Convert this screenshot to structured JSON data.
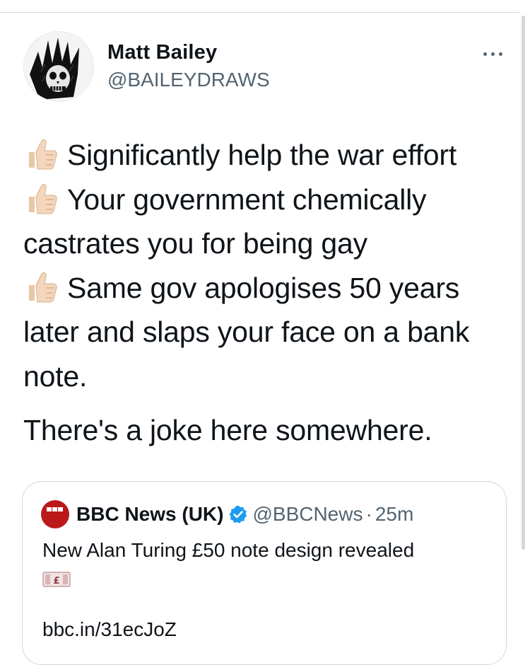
{
  "author": {
    "name": "Matt Bailey",
    "handle": "@BAILEYDRAWS",
    "avatar_icon": "crowned-skeleton-avatar-icon"
  },
  "more_icon": "more-horizontal-icon",
  "tweet": {
    "thumb_icon": "thumbs-up-emoji-icon",
    "items": [
      {
        "lines": [
          "Significantly help the war effort"
        ]
      },
      {
        "lines": [
          "Your government chemically",
          "castrates you for being gay"
        ]
      },
      {
        "lines": [
          "Same gov apologises 50 years",
          "later and slaps your face on a bank",
          "note."
        ]
      }
    ],
    "closing": "There's a joke here somewhere."
  },
  "quoted_tweet": {
    "logo_icon": "bbc-news-logo-icon",
    "name": "BBC News (UK)",
    "verified_icon": "verified-badge-icon",
    "handle": "@BBCNews",
    "separator": "·",
    "time": "25m",
    "text": "New Alan Turing £50 note design revealed",
    "emoji_icon": "pound-banknote-emoji-icon",
    "link": "bbc.in/31ecJoZ"
  },
  "colors": {
    "text": "#0f1419",
    "secondary": "#536471",
    "border": "#cfd9de",
    "verified": "#1d9bf0",
    "bbc_red": "#bb1919"
  }
}
